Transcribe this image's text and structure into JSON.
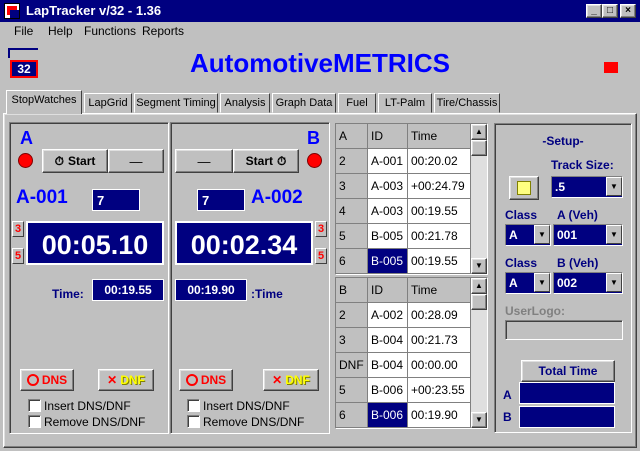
{
  "window": {
    "title": "LapTracker v/32 - 1.36",
    "minimize": "_",
    "maximize": "□",
    "close": "×"
  },
  "menu": [
    "File",
    "Help",
    "Functions",
    "Reports"
  ],
  "header": {
    "logo_num": "32",
    "brand": "AutomotiveMETRICS"
  },
  "tabs": [
    "StopWatches",
    "LapGrid",
    "Segment Timing",
    "Analysis",
    "Graph Data",
    "Fuel",
    "LT-Palm",
    "Tire/Chassis"
  ],
  "watchA": {
    "letter": "A",
    "start_label": "Start",
    "blank_label": "—",
    "vehicle": "A-001",
    "entry": "7",
    "counter_up": "3",
    "counter_down": "5",
    "clock": "00:05.10",
    "time_label": "Time:",
    "time_value": "00:19.55",
    "dns_label": "DNS",
    "dnf_label": "DNF",
    "insert_label": "Insert DNS/DNF",
    "remove_label": "Remove DNS/DNF"
  },
  "watchB": {
    "letter": "B",
    "start_label": "Start",
    "blank_label": "—",
    "vehicle": "A-002",
    "entry": "7",
    "counter_up": "3",
    "counter_down": "5",
    "clock": "00:02.34",
    "time_label": ":Time",
    "time_value": "00:19.90",
    "dns_label": "DNS",
    "dnf_label": "DNF",
    "insert_label": "Insert DNS/DNF",
    "remove_label": "Remove DNS/DNF"
  },
  "gridA": {
    "headers": [
      "A",
      "ID",
      "Time"
    ],
    "rows": [
      [
        "2",
        "A-001",
        "00:20.02"
      ],
      [
        "3",
        "A-003",
        "+00:24.79"
      ],
      [
        "4",
        "A-003",
        "00:19.55"
      ],
      [
        "5",
        "B-005",
        "00:21.78"
      ],
      [
        "6",
        "B-005",
        "00:19.55"
      ]
    ]
  },
  "gridB": {
    "headers": [
      "B",
      "ID",
      "Time"
    ],
    "rows": [
      [
        "2",
        "A-002",
        "00:28.09"
      ],
      [
        "3",
        "B-004",
        "00:21.73"
      ],
      [
        "DNF",
        "B-004",
        "00:00.00"
      ],
      [
        "5",
        "B-006",
        "+00:23.55"
      ],
      [
        "6",
        "B-006",
        "00:19.90"
      ]
    ]
  },
  "setup": {
    "title": "-Setup-",
    "track_size_label": "Track Size:",
    "track_size": ".5",
    "class_label": "Class",
    "classA_veh_label": "A (Veh)",
    "classA": "A",
    "vehA": "001",
    "classB_veh_label": "B (Veh)",
    "classB": "A",
    "vehB": "002",
    "userlogo_label": "UserLogo:",
    "total_time_label": "Total Time",
    "row_a": "A",
    "row_b": "B"
  },
  "colors": {
    "navy": "#000080",
    "brand_blue": "#0000ff",
    "red": "#ff0000"
  }
}
